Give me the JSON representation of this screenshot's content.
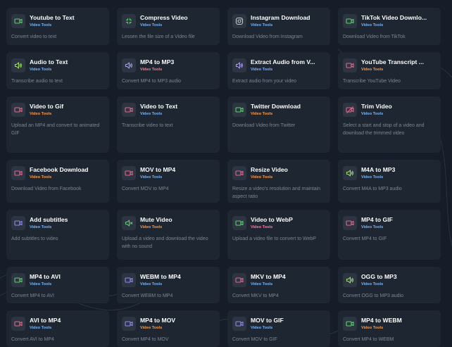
{
  "colors": {
    "video_green": "#58d36a",
    "video_pink": "#e4678e",
    "video_purple": "#8f8cf2",
    "audio_green": "#9be05c",
    "audio_purple": "#a99bf0",
    "badge_blue": "#79b7ff",
    "badge_orange": "#ff9a4a",
    "badge_pink": "#ff7c9c"
  },
  "tools": [
    {
      "title": "Youtube to Text",
      "badge": "Video Tools",
      "desc": "Convert video to text",
      "icon": "video-camera-icon"
    },
    {
      "title": "Compress Video",
      "badge": "Video Tools",
      "desc": "Lessen the file size of a Video file",
      "icon": "compress-icon"
    },
    {
      "title": "Instagram Download",
      "badge": "Video Tools",
      "desc": "Download Video from Instagram",
      "icon": "instagram-icon"
    },
    {
      "title": "TikTok Video Downlo...",
      "badge": "Video Tools",
      "desc": "Download Video from TikTok",
      "icon": "video-camera-icon"
    },
    {
      "title": "Audio to Text",
      "badge": "Video Tools",
      "desc": "Transcribe audio to text",
      "icon": "speaker-icon"
    },
    {
      "title": "MP4 to MP3",
      "badge": "Video Tools",
      "desc": "Convert MP4 to MP3 audio",
      "icon": "speaker-icon"
    },
    {
      "title": "Extract Audio from V...",
      "badge": "Video Tools",
      "desc": "Extract audio from your video",
      "icon": "speaker-icon"
    },
    {
      "title": "YouTube Transcript ...",
      "badge": "Video Tools",
      "desc": "Transcribe YouTube Video",
      "icon": "video-camera-icon"
    },
    {
      "title": "Video to Gif",
      "badge": "Video Tools",
      "desc": "Upload an MP4 and convert to animated GIF",
      "icon": "video-camera-icon"
    },
    {
      "title": "Video to Text",
      "badge": "Video Tools",
      "desc": "Transcribe video to text",
      "icon": "video-camera-icon"
    },
    {
      "title": "Twitter Download",
      "badge": "Video Tools",
      "desc": "Download Video from Twitter",
      "icon": "video-camera-icon"
    },
    {
      "title": "Trim Video",
      "badge": "Video Tools",
      "desc": "Select a start and stop of a video and download the trimmed video",
      "icon": "video-off-icon"
    },
    {
      "title": "Facebook Download",
      "badge": "Video Tools",
      "desc": "Download Video from Facebook",
      "icon": "video-camera-icon"
    },
    {
      "title": "MOV to MP4",
      "badge": "Video Tools",
      "desc": "Convert MOV to MP4",
      "icon": "video-camera-icon"
    },
    {
      "title": "Resize Video",
      "badge": "Video Tools",
      "desc": "Resize a video's resolution and maintain aspect ratio",
      "icon": "video-camera-icon"
    },
    {
      "title": "M4A to MP3",
      "badge": "Video Tools",
      "desc": "Convert M4A to MP3 audio",
      "icon": "speaker-icon"
    },
    {
      "title": "Add subtitles",
      "badge": "Video Tools",
      "desc": "Add subtitles to video",
      "icon": "video-camera-icon"
    },
    {
      "title": "Mute Video",
      "badge": "Video Tools",
      "desc": "Upload a video and download the video with no sound",
      "icon": "mute-icon"
    },
    {
      "title": "Video to WebP",
      "badge": "Video Tools",
      "desc": "Upload a video file to convert to WebP",
      "icon": "video-camera-icon"
    },
    {
      "title": "MP4 to GIF",
      "badge": "Video Tools",
      "desc": "Convert MP4 to GIF",
      "icon": "video-camera-icon"
    },
    {
      "title": "MP4 to AVI",
      "badge": "Video Tools",
      "desc": "Convert MP4 to AVI",
      "icon": "video-camera-icon"
    },
    {
      "title": "WEBM to MP4",
      "badge": "Video Tools",
      "desc": "Convert WEBM to MP4",
      "icon": "video-camera-icon"
    },
    {
      "title": "MKV to MP4",
      "badge": "Video Tools",
      "desc": "Convert MKV to MP4",
      "icon": "video-camera-icon"
    },
    {
      "title": "OGG to MP3",
      "badge": "Video Tools",
      "desc": "Convert OGG to MP3 audio",
      "icon": "speaker-icon"
    },
    {
      "title": "AVI to MP4",
      "badge": "Video Tools",
      "desc": "Convert AVI to MP4",
      "icon": "video-camera-icon"
    },
    {
      "title": "MP4 to MOV",
      "badge": "Video Tools",
      "desc": "Convert MP4 to MOV",
      "icon": "video-camera-icon"
    },
    {
      "title": "MOV to GIF",
      "badge": "Video Tools",
      "desc": "Convert MOV to GIF",
      "icon": "video-camera-icon"
    },
    {
      "title": "MP4 to WEBM",
      "badge": "Video Tools",
      "desc": "Convert MP4 to WEBM",
      "icon": "video-camera-icon"
    }
  ]
}
